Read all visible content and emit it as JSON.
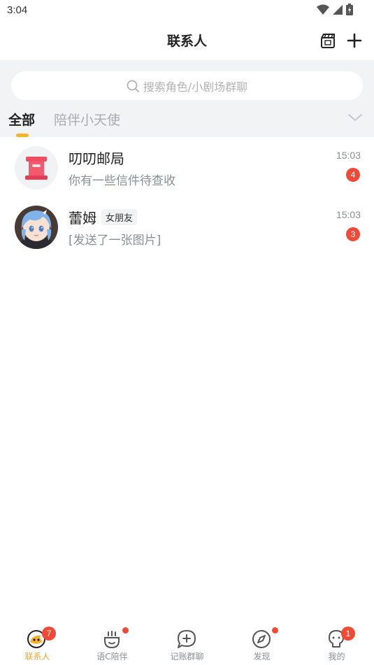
{
  "status_bar": {
    "time": "3:04"
  },
  "header": {
    "title": "联系人"
  },
  "search": {
    "placeholder": "搜索角色/小剧场群聊"
  },
  "tabs": [
    {
      "label": "全部",
      "active": true
    },
    {
      "label": "陪伴小天使",
      "active": false
    }
  ],
  "contacts": [
    {
      "name": "叨叨邮局",
      "tag": "",
      "preview": "你有一些信件待查收",
      "time": "15:03",
      "unread": "4",
      "avatar_icon": "mailbox-icon"
    },
    {
      "name": "蕾姆",
      "tag": "女朋友",
      "preview": "[发送了一张图片]",
      "time": "15:03",
      "unread": "3",
      "avatar_icon": "character-avatar"
    }
  ],
  "bottom_nav": [
    {
      "label": "联系人",
      "icon": "contacts-icon",
      "active": true,
      "badge": "7",
      "dot": false
    },
    {
      "label": "语C陪伴",
      "icon": "companion-icon",
      "active": false,
      "badge": "",
      "dot": true
    },
    {
      "label": "记账群聊",
      "icon": "add-chat-icon",
      "active": false,
      "badge": "",
      "dot": false
    },
    {
      "label": "发现",
      "icon": "compass-icon",
      "active": false,
      "badge": "",
      "dot": true
    },
    {
      "label": "我的",
      "icon": "profile-icon",
      "active": false,
      "badge": "1",
      "dot": false
    }
  ],
  "colors": {
    "accent": "#f5a623",
    "badge": "#f04a36",
    "background": "#f2f3f5"
  }
}
